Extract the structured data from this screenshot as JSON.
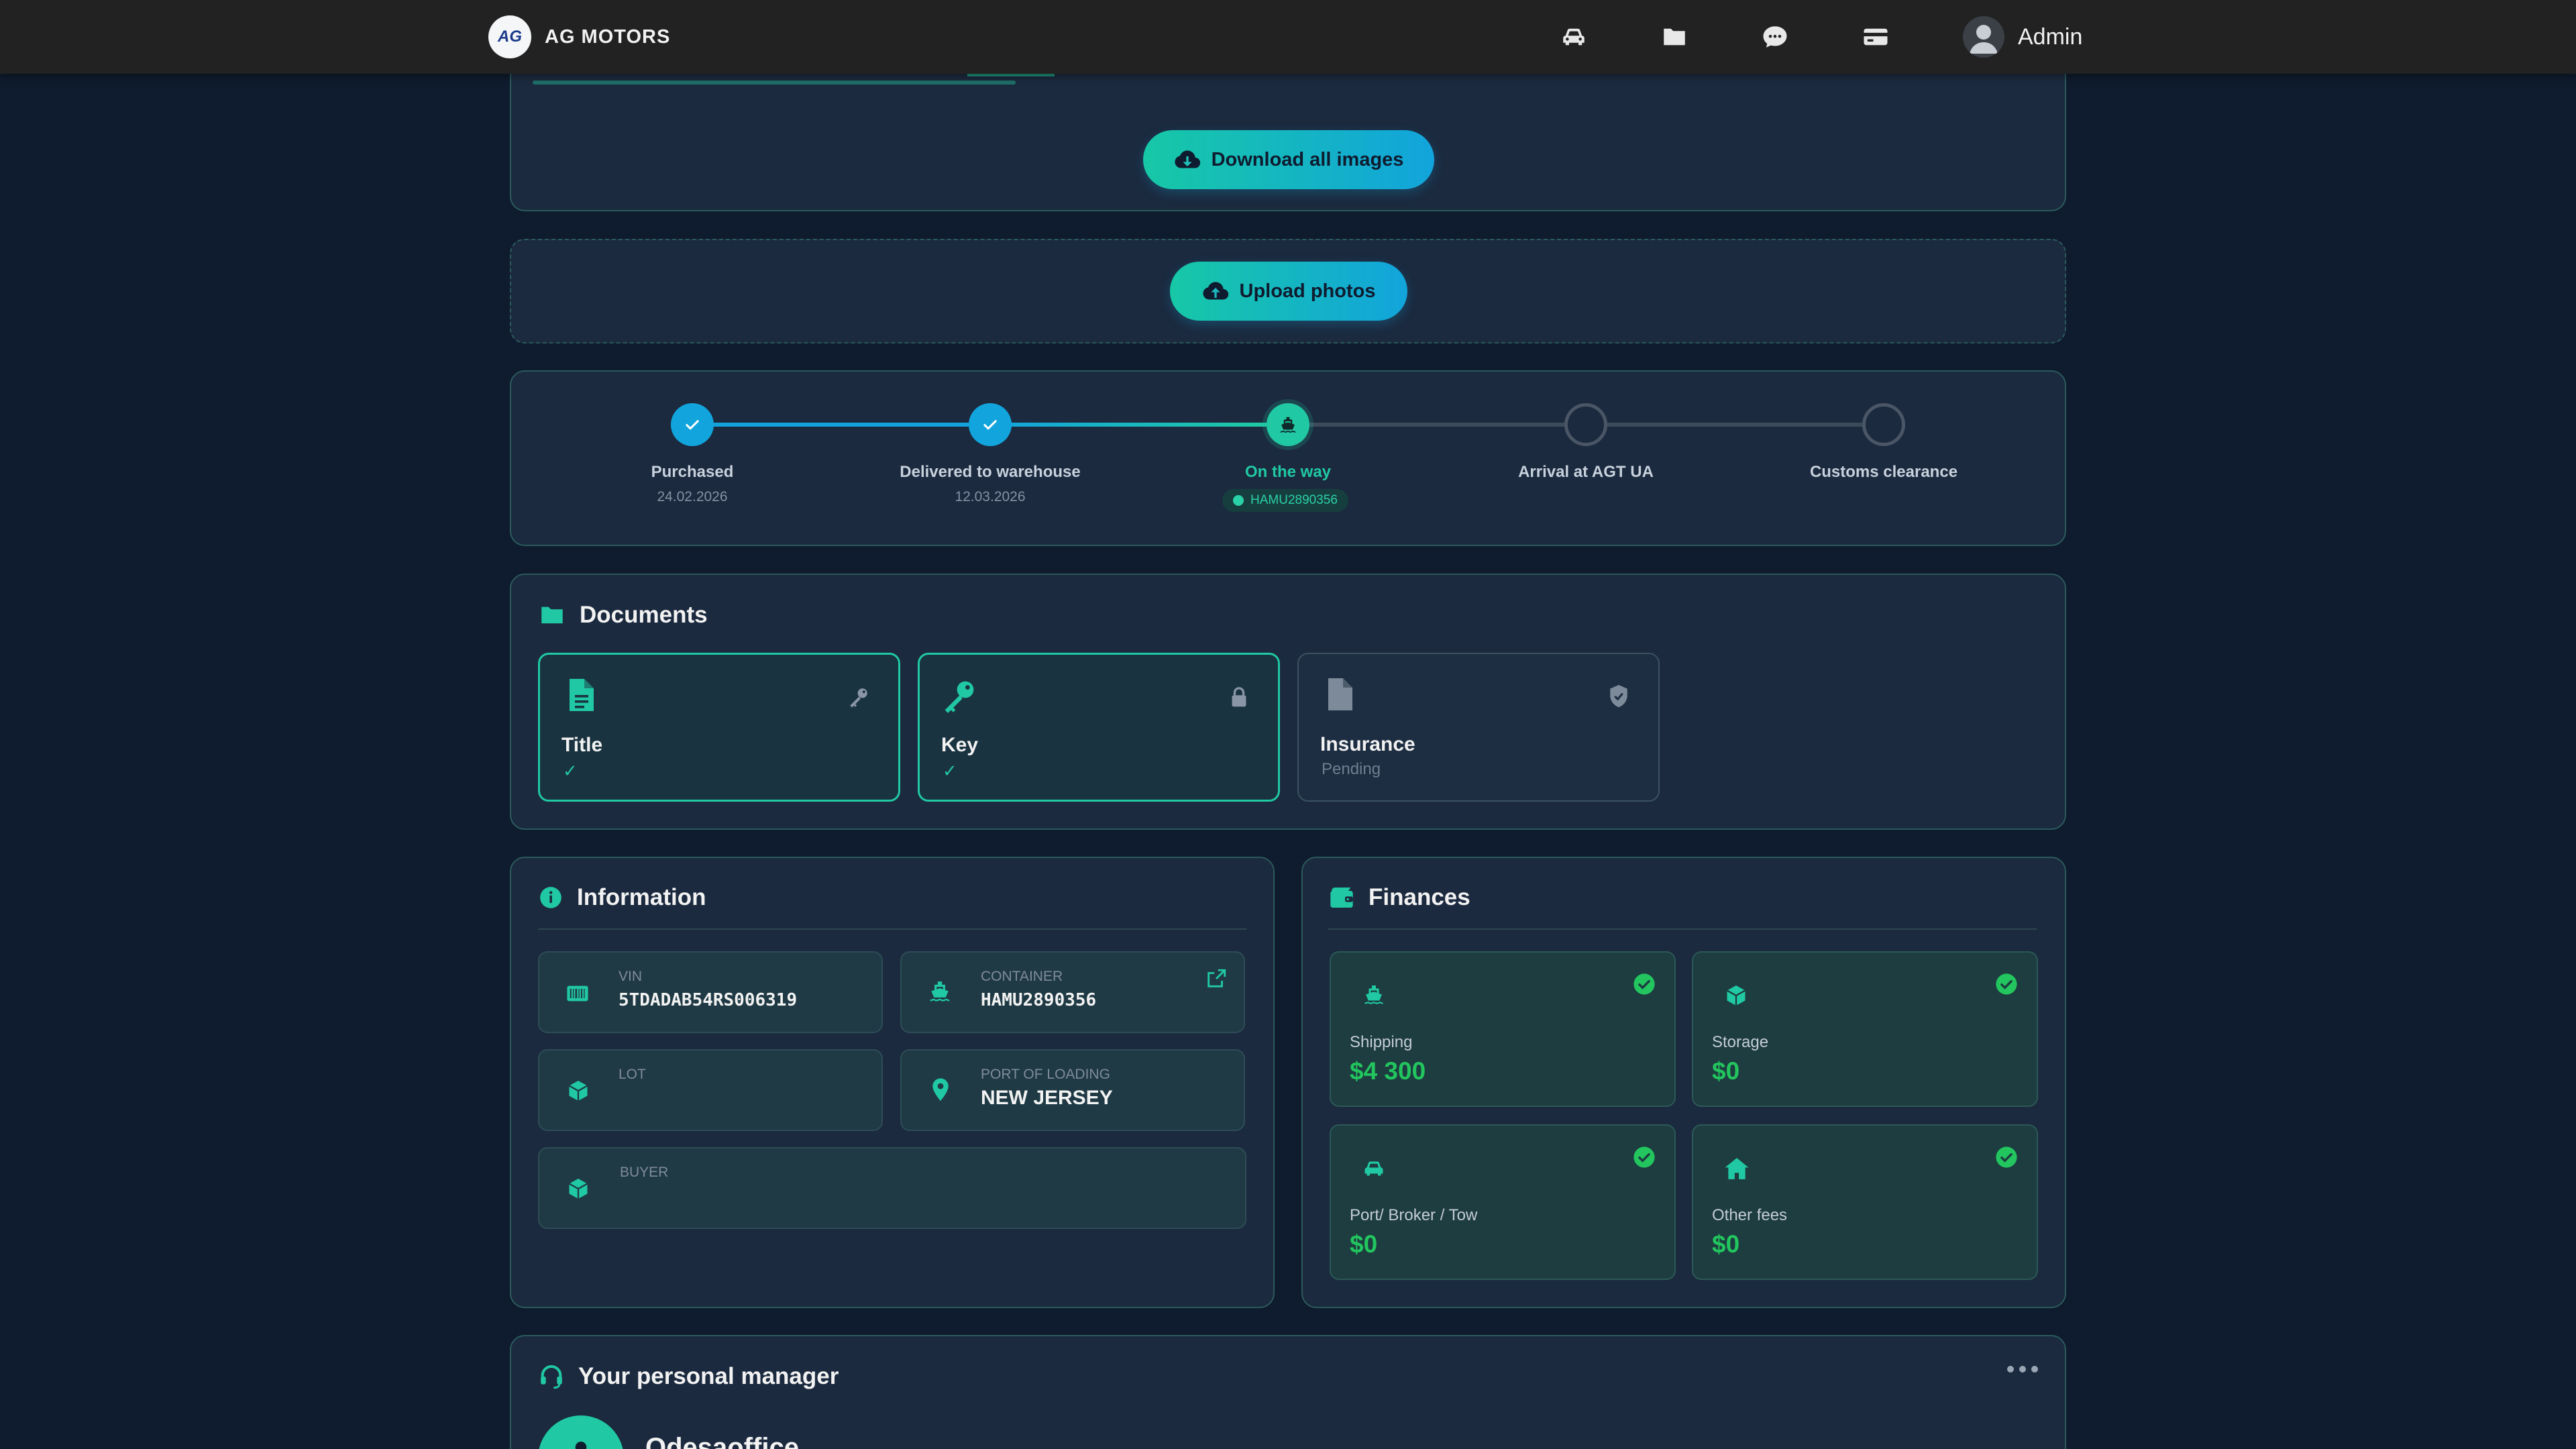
{
  "header": {
    "logo_text": "AG",
    "brand": "AG MOTORS",
    "nav_icons": [
      "car-icon",
      "folder-icon",
      "chat-icon",
      "card-icon"
    ],
    "user_name": "Admin"
  },
  "gallery": {
    "download_label": "Download all images"
  },
  "upload": {
    "upload_label": "Upload photos"
  },
  "progress": {
    "steps": [
      {
        "label": "Purchased",
        "date": "24.02.2026",
        "status": "done"
      },
      {
        "label": "Delivered to warehouse",
        "date": "12.03.2026",
        "status": "done"
      },
      {
        "label": "On the way",
        "badge": "HAMU2890356",
        "status": "current"
      },
      {
        "label": "Arrival at AGT UA",
        "status": "pending"
      },
      {
        "label": "Customs clearance",
        "status": "pending"
      }
    ]
  },
  "documents": {
    "title": "Documents",
    "items": [
      {
        "name": "Title",
        "status": "✓",
        "icon": "document-icon",
        "corner_icon": "key-icon"
      },
      {
        "name": "Key",
        "status": "✓",
        "icon": "key-icon",
        "corner_icon": "lock-icon"
      },
      {
        "name": "Insurance",
        "status": "Pending",
        "icon": "document-icon",
        "corner_icon": "shield-icon"
      }
    ]
  },
  "information": {
    "title": "Information",
    "vin_label": "VIN",
    "vin": "5TDADAB54RS006319",
    "container_label": "CONTAINER",
    "container": "HAMU2890356",
    "lot_label": "LOT",
    "lot": "",
    "port_label": "PORT OF LOADING",
    "port": "NEW JERSEY",
    "buyer_label": "BUYER",
    "buyer": ""
  },
  "finances": {
    "title": "Finances",
    "items": [
      {
        "label": "Shipping",
        "value": "$4 300",
        "icon": "ship-icon"
      },
      {
        "label": "Storage",
        "value": "$0",
        "icon": "box-icon"
      },
      {
        "label": "Port/ Broker / Tow",
        "value": "$0",
        "icon": "car-icon"
      },
      {
        "label": "Other fees",
        "value": "$0",
        "icon": "home-icon"
      }
    ]
  },
  "manager": {
    "title": "Your personal manager",
    "name": "Odesaoffice"
  },
  "colors": {
    "background": "#0f1b2e",
    "card": "#1b2a3f",
    "accent_teal": "#20c9a3",
    "accent_blue": "#12a4dc",
    "money_green": "#22c55e"
  }
}
